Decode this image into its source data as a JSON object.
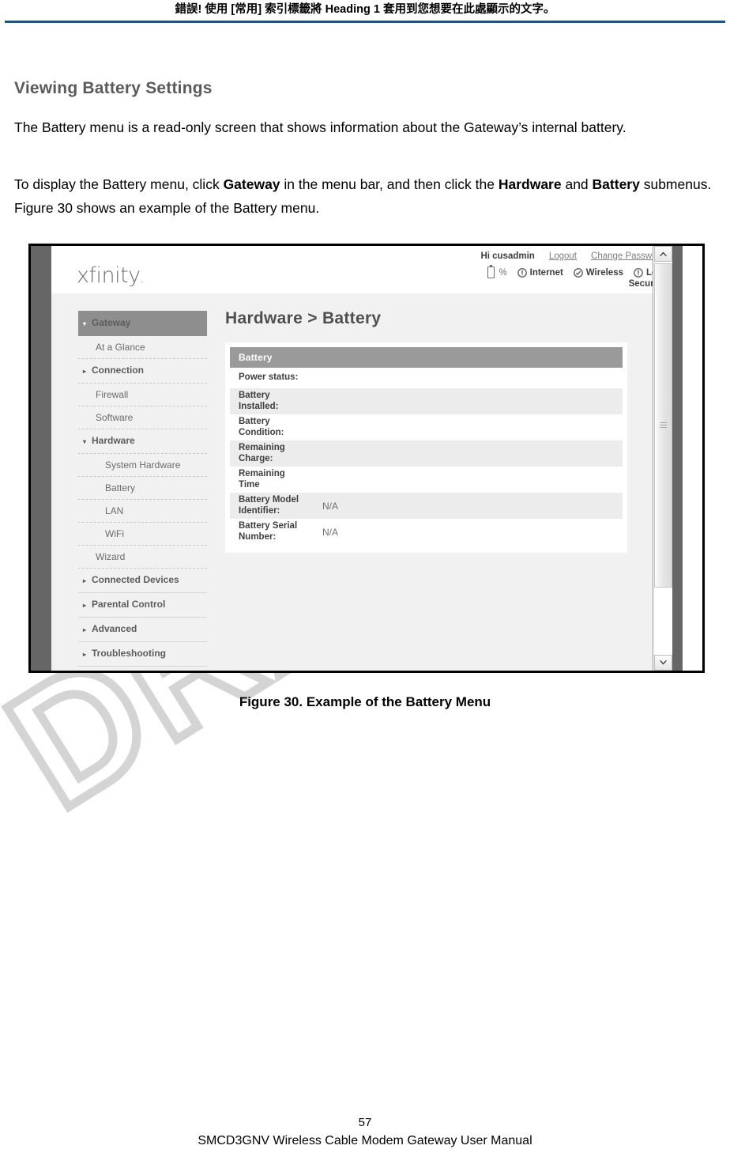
{
  "document": {
    "header_text": "錯誤! 使用 [常用] 索引標籤將 Heading 1 套用到您想要在此處顯示的文字。",
    "header_rule_color": "#2a5170",
    "watermark_text": "DRAFT",
    "section_title": "Viewing Battery Settings",
    "paragraph_1": "The Battery menu is a read-only screen that shows information about the Gateway’s internal battery.",
    "paragraph_2_part_1": "To display the Battery menu, click ",
    "paragraph_2_bold_1": "Gateway",
    "paragraph_2_part_2": " in the menu bar, and then click the ",
    "paragraph_2_bold_2": "Hardware",
    "paragraph_2_part_3": " and ",
    "paragraph_2_bold_3": "Battery",
    "paragraph_2_part_4": " submenus. Figure 30 shows an example of the Battery menu.",
    "figure_caption": "Figure 30. Example of the Battery Menu",
    "page_number": "57",
    "footer_text": "SMCD3GNV Wireless Cable Modem Gateway User Manual"
  },
  "screenshot": {
    "brand": {
      "logo_text": "xfinity",
      "logo_dot": "."
    },
    "status": {
      "greeting": "Hi cusadmin",
      "logout_label": "Logout",
      "change_password_label": "Change Password",
      "battery_icon": "battery-icon",
      "battery_percent": "%",
      "internet_label": "Internet",
      "internet_icon": "status-alert-icon",
      "wireless_label": "Wireless",
      "wireless_icon": "status-check-icon",
      "security_label": "Low",
      "security_label_2": "Security",
      "security_icon": "status-alert-icon"
    },
    "sidebar": {
      "items": [
        {
          "label": "Gateway",
          "level": "top",
          "state": "active",
          "arrow": "▾"
        },
        {
          "label": "At a Glance",
          "level": "1",
          "state": "normal",
          "arrow": ""
        },
        {
          "label": "Connection",
          "level": "1",
          "state": "normal",
          "arrow": "▸"
        },
        {
          "label": "Firewall",
          "level": "1",
          "state": "normal",
          "arrow": ""
        },
        {
          "label": "Software",
          "level": "1",
          "state": "normal",
          "arrow": ""
        },
        {
          "label": "Hardware",
          "level": "1",
          "state": "expanded",
          "arrow": "▾"
        },
        {
          "label": "System Hardware",
          "level": "2",
          "state": "normal",
          "arrow": ""
        },
        {
          "label": "Battery",
          "level": "2",
          "state": "normal",
          "arrow": ""
        },
        {
          "label": "LAN",
          "level": "2",
          "state": "normal",
          "arrow": ""
        },
        {
          "label": "WiFi",
          "level": "2",
          "state": "normal",
          "arrow": ""
        },
        {
          "label": "Wizard",
          "level": "1",
          "state": "normal",
          "arrow": ""
        },
        {
          "label": "Connected Devices",
          "level": "top",
          "state": "normal",
          "arrow": "▸"
        },
        {
          "label": "Parental Control",
          "level": "top",
          "state": "normal",
          "arrow": "▸"
        },
        {
          "label": "Advanced",
          "level": "top",
          "state": "normal",
          "arrow": "▸"
        },
        {
          "label": "Troubleshooting",
          "level": "top",
          "state": "normal",
          "arrow": "▸"
        }
      ]
    },
    "main": {
      "page_title": "Hardware > Battery",
      "card_header": "Battery",
      "rows": [
        {
          "label": "Power status:",
          "value": ""
        },
        {
          "label": "Battery Installed:",
          "value": ""
        },
        {
          "label": "Battery Condition:",
          "value": ""
        },
        {
          "label": "Remaining\nCharge:",
          "value": ""
        },
        {
          "label": "Remaining Time",
          "value": ""
        },
        {
          "label": "Battery Model\nIdentifier:",
          "value": "N/A"
        },
        {
          "label": "Battery Serial\nNumber:",
          "value": "N/A"
        }
      ]
    },
    "scrollbar": {
      "up_icon": "chevron-up-icon",
      "down_icon": "chevron-down-icon",
      "thumb": "scroll-thumb"
    }
  }
}
